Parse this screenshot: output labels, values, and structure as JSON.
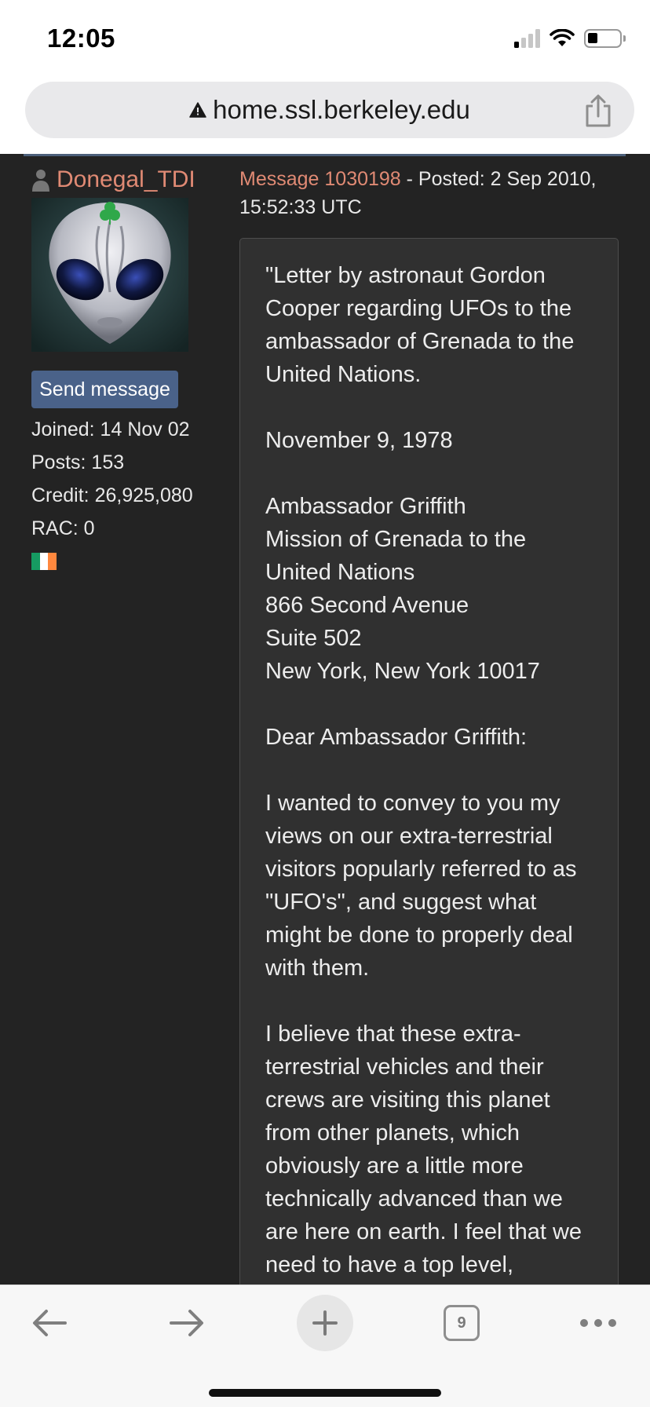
{
  "status_bar": {
    "time": "12:05",
    "icons": [
      "cellular-signal-icon",
      "wifi-icon",
      "battery-icon"
    ]
  },
  "browser": {
    "url": "home.ssl.berkeley.edu",
    "url_icon": "warning-icon",
    "share_icon": "share-icon"
  },
  "user": {
    "name": "Donegal_TDI",
    "send_message_label": "Send message",
    "joined": "Joined: 14 Nov 02",
    "posts": "Posts: 153",
    "credit": "Credit: 26,925,080",
    "rac": "RAC: 0",
    "flag_colors": [
      "#169b62",
      "#ffffff",
      "#ff883e"
    ]
  },
  "message": {
    "link": "Message 1030198",
    "posted": " - Posted: 2 Sep 2010, 15:52:33 UTC",
    "lines": [
      "\"Letter by astronaut Gordon Cooper regarding UFOs to the ambassador of Grenada to the United Nations.",
      "",
      "November 9, 1978",
      "",
      "Ambassador Griffith",
      "Mission of Grenada to the United Nations",
      "866 Second Avenue",
      "Suite 502",
      "New York, New York 10017",
      "",
      "Dear Ambassador Griffith:",
      "",
      "I wanted to convey to you my views on our extra-terrestrial visitors popularly referred to as \"UFO's\", and suggest what might be done to properly deal with them.",
      "",
      "I believe that these extra-terrestrial vehicles and their crews are visiting this planet from other planets, which obviously are a little more technically advanced than we are here on earth. I feel that we need to have a top level,"
    ]
  },
  "toolbar": {
    "tab_count": "9",
    "icons": [
      "back-arrow-icon",
      "forward-arrow-icon",
      "new-tab-plus-icon",
      "tabs-icon",
      "more-icon"
    ]
  },
  "colors": {
    "page_background": "#232323",
    "message_box": "#303030",
    "username_link": "#e08a74",
    "button": "#4a6289"
  }
}
